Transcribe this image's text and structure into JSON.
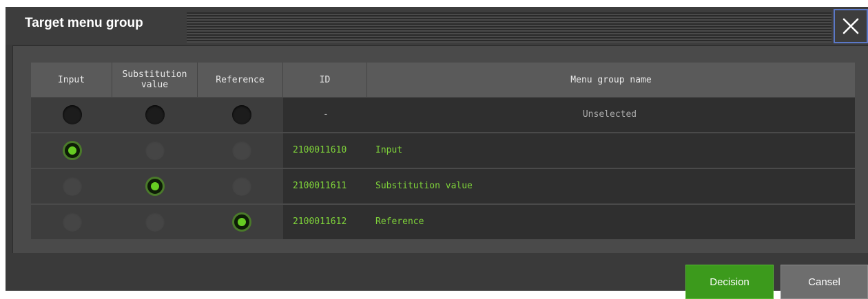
{
  "dialog": {
    "title": "Target menu group",
    "close_icon": "close-icon"
  },
  "table": {
    "columns": [
      "Input",
      "Substitution value",
      "Reference",
      "ID",
      "Menu group name"
    ],
    "rows": [
      {
        "id": "-",
        "name": "Unselected",
        "selected_column": "none"
      },
      {
        "id": "2100011610",
        "name": "Input",
        "selected_column": "Input"
      },
      {
        "id": "2100011611",
        "name": "Substitution value",
        "selected_column": "Substitution value"
      },
      {
        "id": "2100011612",
        "name": "Reference",
        "selected_column": "Reference"
      }
    ]
  },
  "footer": {
    "decision_label": "Decision",
    "cancel_label": "Cansel"
  },
  "colors": {
    "accent_green": "#3c9a1c",
    "selected_text": "#7fd33a",
    "muted_text": "#aaaaaa",
    "close_border": "#5b78c7"
  }
}
